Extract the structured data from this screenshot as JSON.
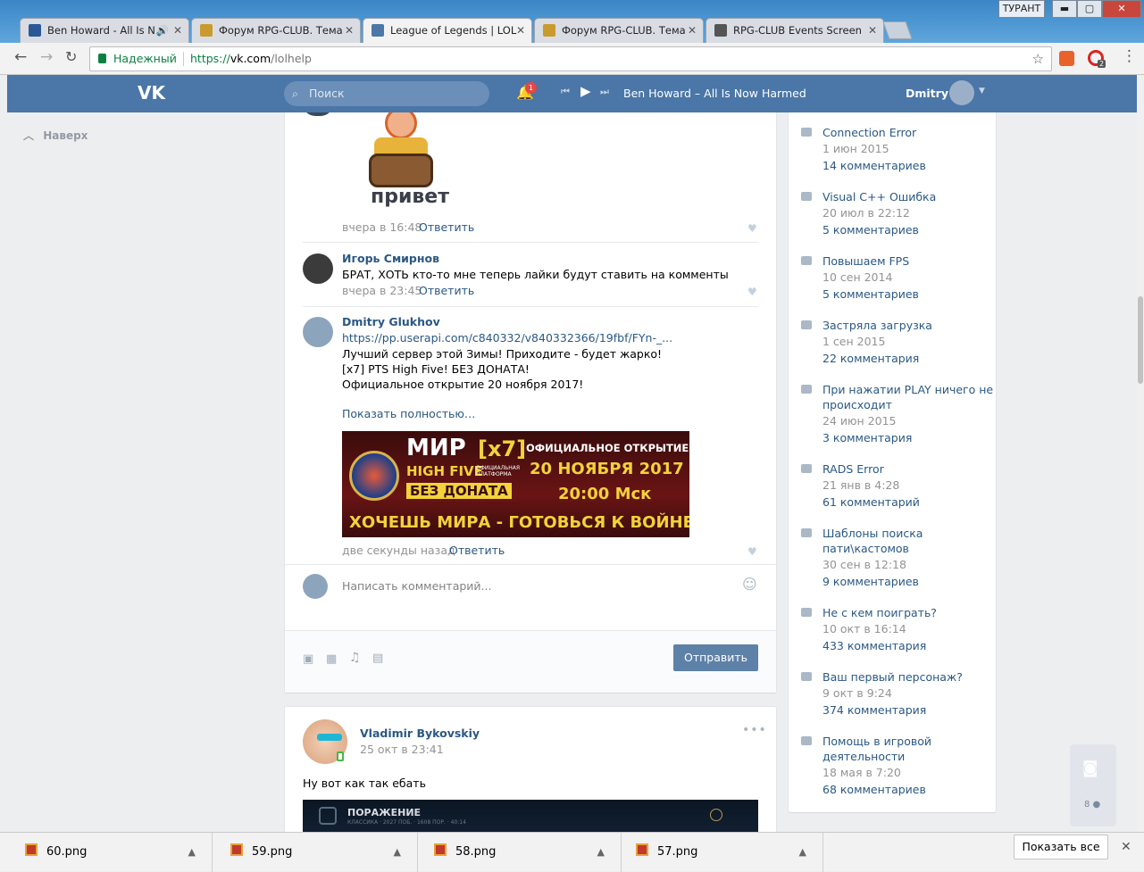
{
  "tabs": [
    {
      "label": "Ben Howard - All Is N",
      "color": "#2b5797"
    },
    {
      "label": "Форум RPG-CLUB. Тема",
      "color": "#c99a2e"
    },
    {
      "label": "League of Legends | LOL",
      "color": "#4a76a8"
    },
    {
      "label": "Форум RPG-CLUB. Тема",
      "color": "#c99a2e"
    },
    {
      "label": "RPG-CLUB Events Screen",
      "color": "#555555"
    }
  ],
  "window": {
    "profile": "ТУРАНТ",
    "minimize": "▬",
    "maximize": "▢",
    "close": "✕"
  },
  "address": {
    "secure_label": "Надежный",
    "url_scheme": "https://",
    "url_host": "vk.com",
    "url_path": "/lolhelp",
    "ext_badge": "2"
  },
  "vk": {
    "search_placeholder": "Поиск",
    "notif_count": "1",
    "track": "Ben Howard – All Is Now Harmed",
    "user": "Dmitry",
    "back_top": "Наверх"
  },
  "comments": [
    {
      "time": "вчера в 16:48",
      "reply": "Ответить",
      "sticker_text": "привет"
    },
    {
      "author": "Игорь Смирнов",
      "text": "БРАТ, ХОТЬ кто-то мне теперь лайки будут ставить на комменты",
      "time": "вчера в 23:45",
      "reply": "Ответить"
    },
    {
      "author": "Dmitry Glukhov",
      "link": "https://pp.userapi.com/c840332/v840332366/19fbf/FYn-_...",
      "lines": [
        "Лучший сервер этой Зимы! Приходите - будет жарко!",
        "[x7] PTS High Five! БЕЗ ДОНАТА!",
        "Официальное открытие 20 ноября 2017!"
      ],
      "show_more": "Показать полностью…",
      "time": "две секунды назад",
      "reply": "Ответить"
    }
  ],
  "banner": {
    "mir": "МИР",
    "x7": "[x7]",
    "open": "ОФИЦИАЛЬНОЕ ОТКРЫТИЕ",
    "high_five": "HIGH FIVE",
    "platform": "ОФИЦИАЛЬНАЯ ПЛАТФОРМА",
    "date": "20 НОЯБРЯ 2017",
    "time": "20:00 Мск",
    "no_donate": "БЕЗ ДОНАТА",
    "slogan": "ХОЧЕШЬ МИРА - ГОТОВЬСЯ К ВОЙНЕ"
  },
  "composer": {
    "placeholder": "Написать комментарий...",
    "send": "Отправить"
  },
  "post2": {
    "author": "Vladimir Bykovskiy",
    "date": "25 окт в 23:41",
    "text": "Ну вот как так ебать",
    "game_label": "ПОРАЖЕНИЕ",
    "game_sub": "КЛАССИКА · 2027 ПОБ. · 1608 ПОР. · 40:14"
  },
  "topics": [
    {
      "title": "Connection Error",
      "date": "1 июн 2015",
      "comments": "14 комментариев"
    },
    {
      "title": "Visual C++ Ошибка",
      "date": "20 июл в 22:12",
      "comments": "5 комментариев"
    },
    {
      "title": "Повышаем FPS",
      "date": "10 сен 2014",
      "comments": "5 комментариев"
    },
    {
      "title": "Застряла загрузка",
      "date": "1 сен 2015",
      "comments": "22 комментария"
    },
    {
      "title": "При нажатии PLAY ничего не происходит",
      "date": "24 июн 2015",
      "comments": "3 комментария"
    },
    {
      "title": "RADS Error",
      "date": "21 янв в 4:28",
      "comments": "61 комментарий"
    },
    {
      "title": "Шаблоны поиска пати\\кастомов",
      "date": "30 сен в 12:18",
      "comments": "9 комментариев"
    },
    {
      "title": "Не с кем поиграть?",
      "date": "10 окт в 16:14",
      "comments": "433 комментария"
    },
    {
      "title": "Ваш первый персонаж?",
      "date": "9 окт в 9:24",
      "comments": "374 комментария"
    },
    {
      "title": "Помощь в игровой деятельности",
      "date": "18 мая в 7:20",
      "comments": "68 комментариев"
    }
  ],
  "photo_widget": {
    "count": "8"
  },
  "downloads": [
    {
      "name": "60.png"
    },
    {
      "name": "59.png"
    },
    {
      "name": "58.png"
    },
    {
      "name": "57.png"
    }
  ],
  "show_all": "Показать все"
}
